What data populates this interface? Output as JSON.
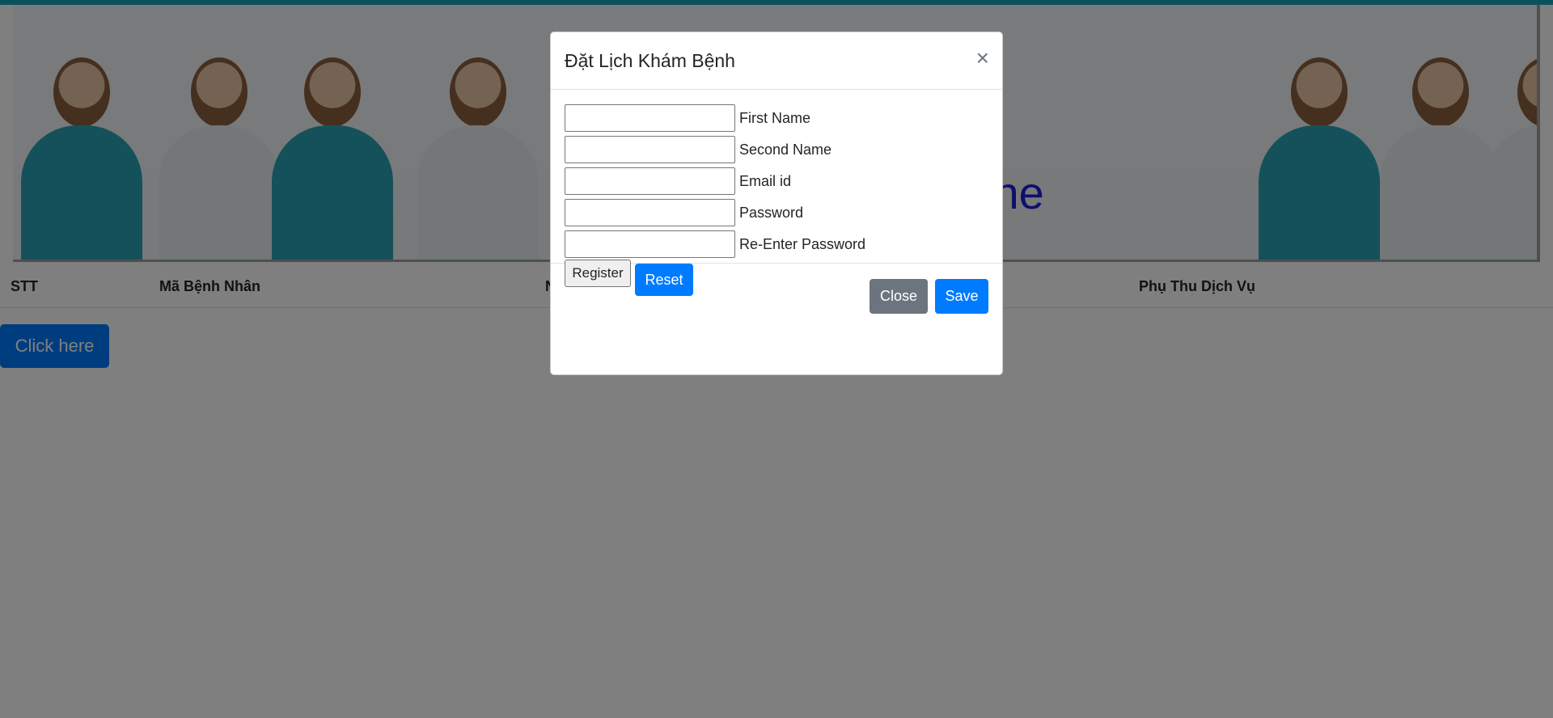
{
  "banner": {
    "partial_text": "ine"
  },
  "table": {
    "headers": [
      "STT",
      "Mã Bệnh Nhân",
      "N",
      "Phụ Thu Dịch Vụ"
    ]
  },
  "click_button": {
    "label": "Click here"
  },
  "modal": {
    "title": "Đặt Lịch Khám Bệnh",
    "close_icon": "×",
    "fields": [
      {
        "label": "First Name",
        "value": ""
      },
      {
        "label": "Second Name",
        "value": ""
      },
      {
        "label": "Email id",
        "value": ""
      },
      {
        "label": "Password",
        "value": ""
      },
      {
        "label": "Re-Enter Password",
        "value": ""
      }
    ],
    "register_label": "Register",
    "reset_label": "Reset",
    "footer": {
      "close_label": "Close",
      "save_label": "Save"
    }
  },
  "colors": {
    "accent": "#17a2b8",
    "primary": "#007bff",
    "secondary": "#6c757d"
  }
}
